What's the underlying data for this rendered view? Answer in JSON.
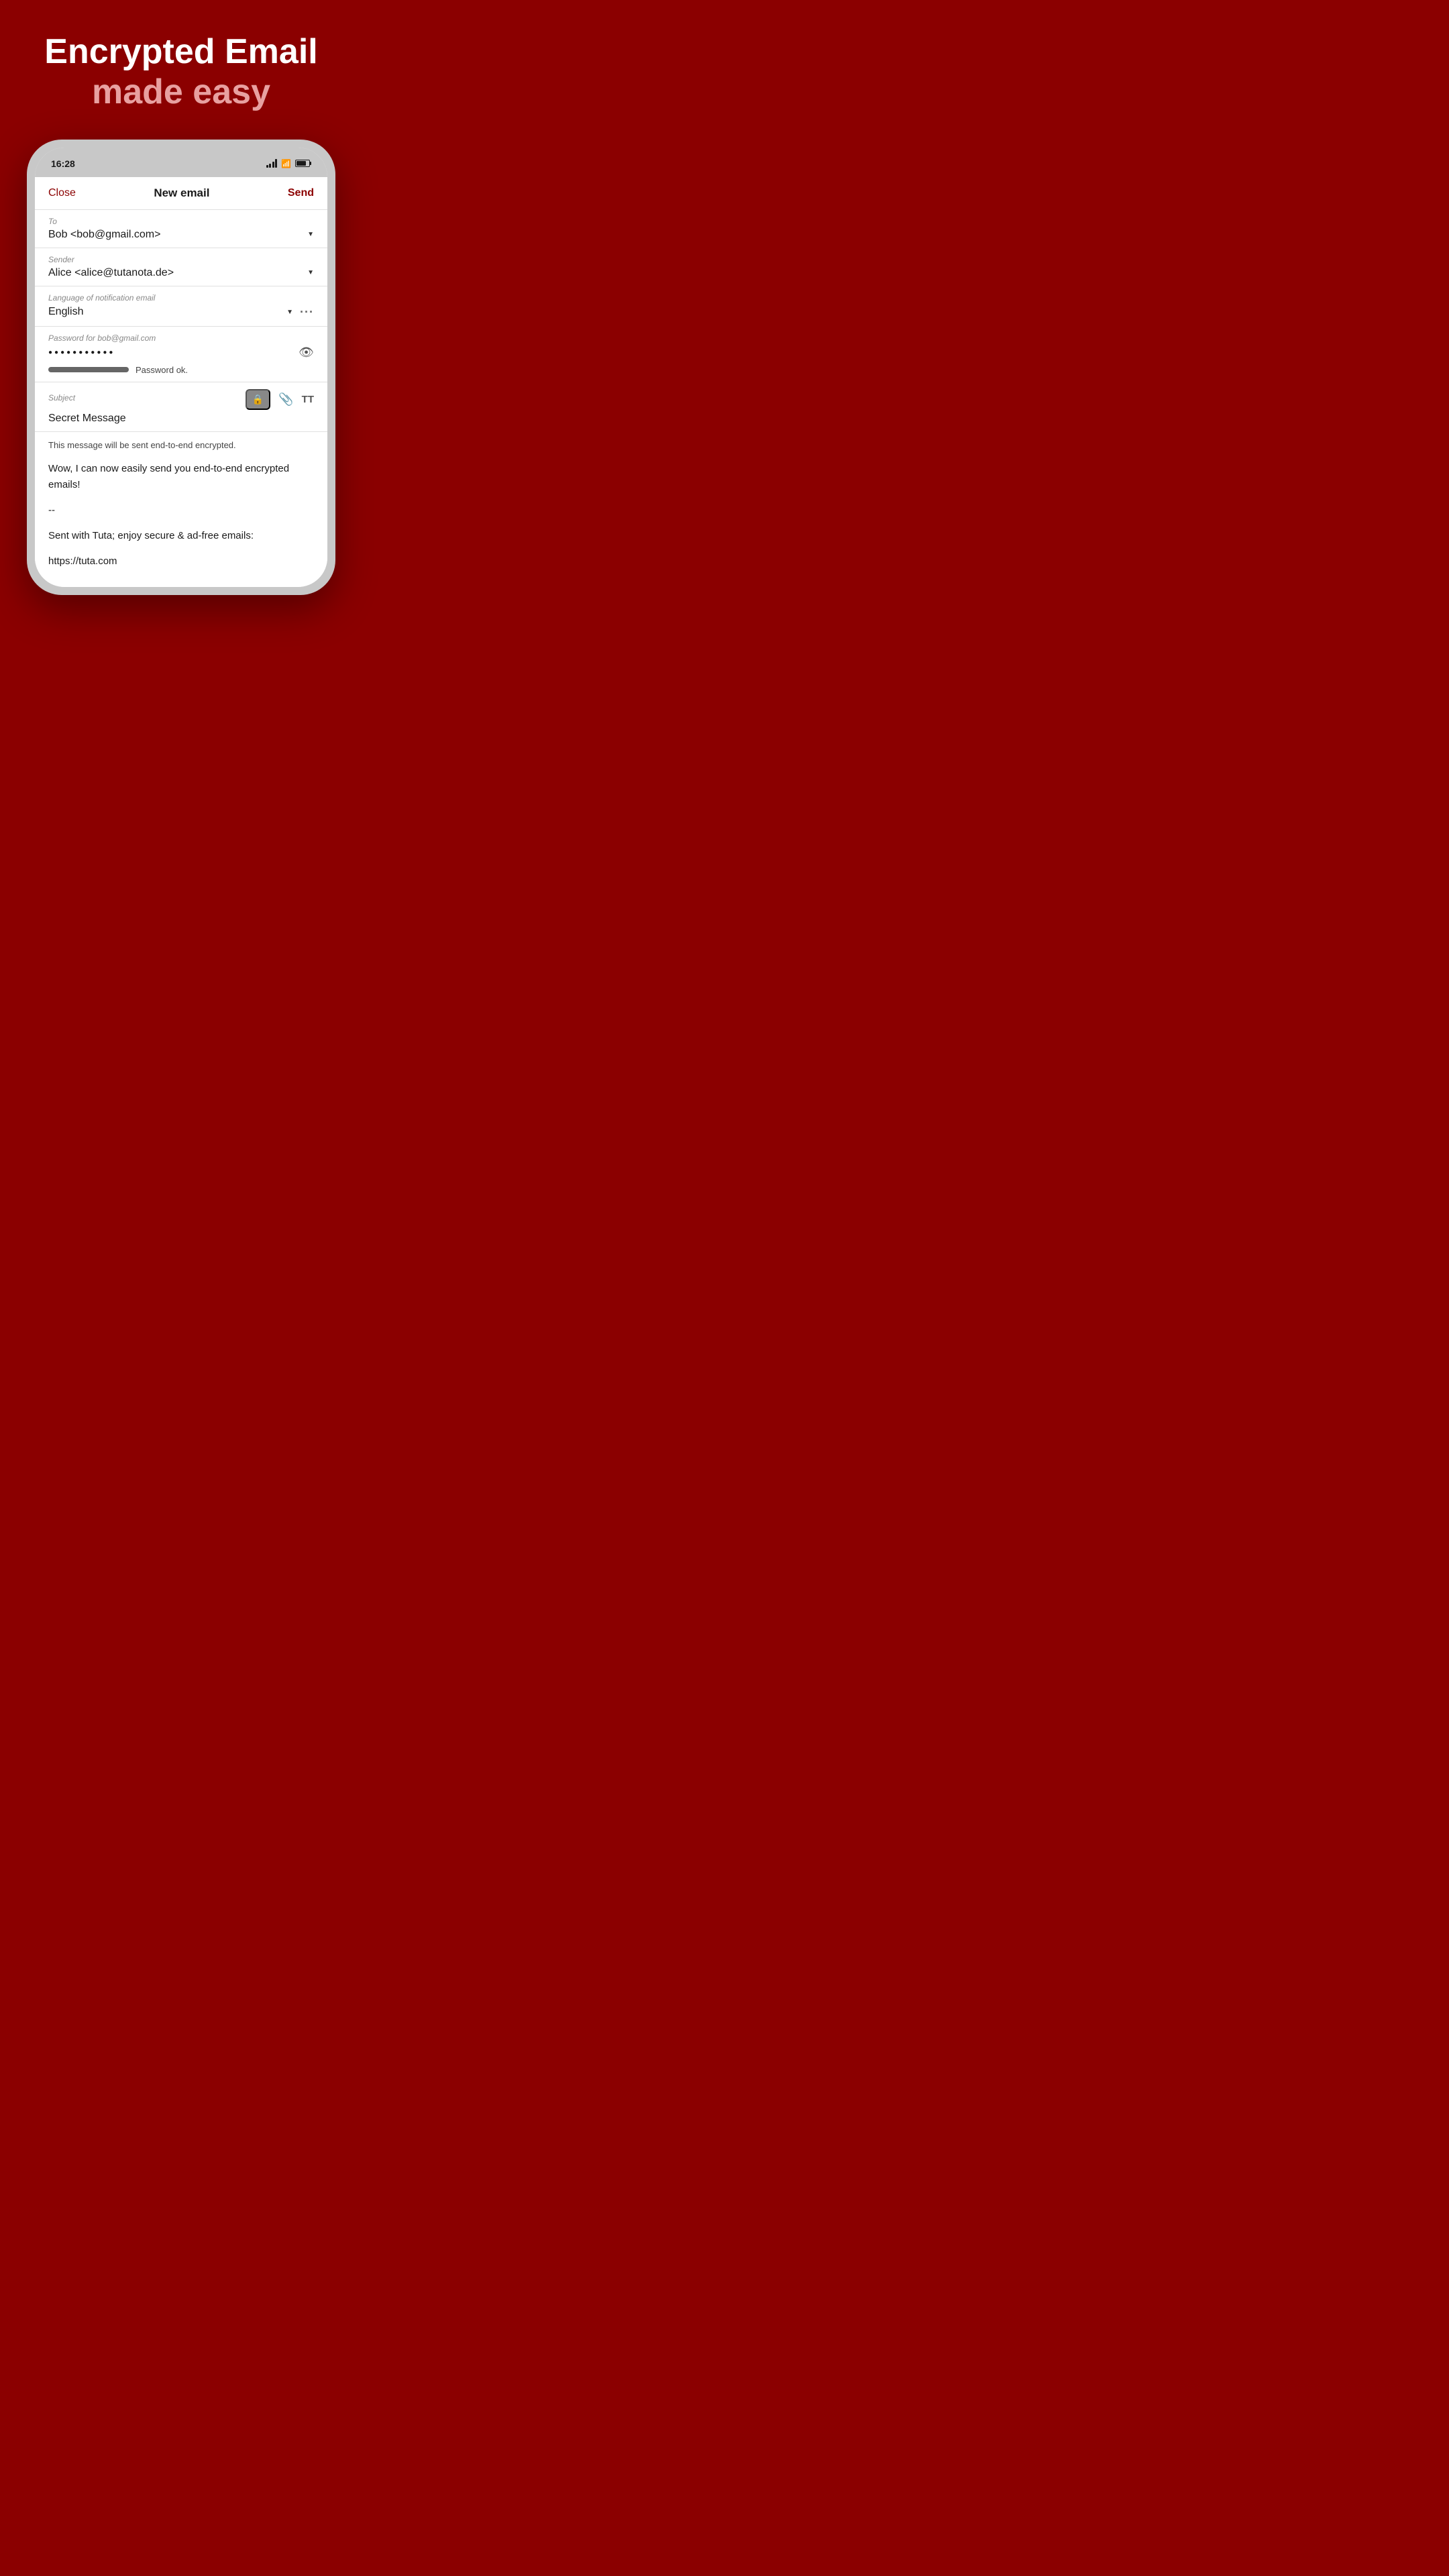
{
  "hero": {
    "title": "Encrypted Email",
    "subtitle": "made easy"
  },
  "status_bar": {
    "time": "16:28"
  },
  "email_compose": {
    "close_label": "Close",
    "title": "New email",
    "send_label": "Send",
    "to_label": "To",
    "to_value": "Bob <bob@gmail.com>",
    "sender_label": "Sender",
    "sender_value": "Alice <alice@tutanota.de>",
    "notification_lang_label": "Language of notification email",
    "notification_lang_value": "English",
    "password_label": "Password for bob@gmail.com",
    "password_dots": "●●●●●●●●●●●",
    "password_status": "Password ok.",
    "subject_label": "Subject",
    "subject_value": "Secret Message",
    "encrypted_notice": "This message will be sent end-to-end encrypted.",
    "body_text": "Wow, I can now easily send you end-to-end encrypted emails!",
    "signature_separator": "--",
    "signature_line1": "Sent with Tuta; enjoy secure & ad-free emails:",
    "signature_line2": "https://tuta.com"
  }
}
